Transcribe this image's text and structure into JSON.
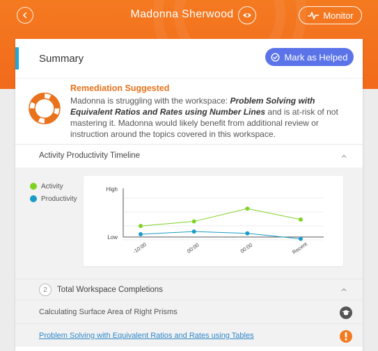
{
  "header": {
    "student_name": "Madonna Sherwood",
    "monitor_label": "Monitor",
    "colors": {
      "header": "#f47a20",
      "white": "#ffffff"
    },
    "icons": {
      "back": "chevron-left-icon",
      "view": "eye-icon",
      "monitor": "heartbeat-icon"
    }
  },
  "summary": {
    "title": "Summary",
    "helped_label": "Mark as Helped",
    "helped_icon": "clock-check-icon",
    "accent": "#1ea7d6",
    "button_color": "#5b73e8"
  },
  "remediation": {
    "title": "Remediation Suggested",
    "text_before": "Madonna is struggling with the workspace: ",
    "workspace": "Problem Solving with Equivalent Ratios and Rates using Number Lines",
    "text_after": " and is at-risk of not mastering it. Madonna would likely benefit from additional review or instruction around the topics covered in this workspace.",
    "icon": "life-ring-icon",
    "color": "#e9721c"
  },
  "timeline": {
    "title": "Activity Productivity Timeline",
    "legend": [
      {
        "label": "Activity",
        "color": "#7ed321"
      },
      {
        "label": "Productivity",
        "color": "#1a9bc7"
      }
    ]
  },
  "chart_data": {
    "type": "line",
    "categories": [
      "-10:00",
      "00:00",
      "00:00",
      "Recent"
    ],
    "y_tick_labels": [
      "High",
      "Low"
    ],
    "ylim": [
      0,
      1
    ],
    "series": [
      {
        "name": "Activity",
        "color": "#7ed321",
        "values": [
          0.24,
          0.34,
          0.62,
          0.38
        ]
      },
      {
        "name": "Productivity",
        "color": "#1a9bc7",
        "values": [
          0.06,
          0.12,
          0.08,
          -0.04
        ]
      }
    ]
  },
  "completions": {
    "count": "2",
    "title": "Total Workspace Completions",
    "items": [
      {
        "label": "Calculating Surface Area of Right Prisms",
        "icon": "graduation-cap-icon",
        "icon_color": "#555555",
        "link": false
      },
      {
        "label": "Problem Solving with Equivalent Ratios and Rates using Tables",
        "icon": "exclamation-icon",
        "icon_color": "#f47a20",
        "link": true
      }
    ]
  }
}
